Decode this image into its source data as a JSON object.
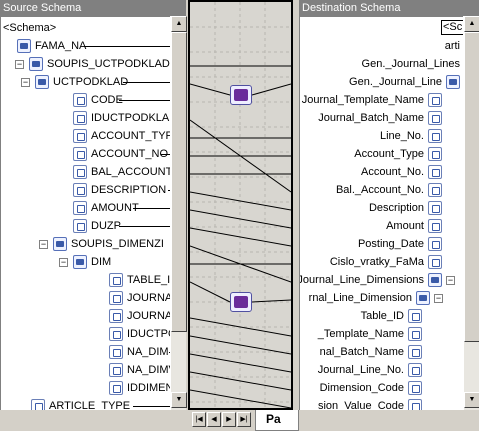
{
  "source": {
    "title": "Source Schema",
    "header_row": "<Schema>",
    "nodes": [
      {
        "label": "FAMA_NA",
        "kind": "record"
      },
      {
        "label": "SOUPIS_UCTPODKLADU",
        "kind": "record"
      },
      {
        "label": "UCTPODKLAD",
        "kind": "record"
      },
      {
        "label": "CODE",
        "kind": "field"
      },
      {
        "label": "IDUCTPODKLAD",
        "kind": "field"
      },
      {
        "label": "ACCOUNT_TYPE",
        "kind": "field"
      },
      {
        "label": "ACCOUNT_NO",
        "kind": "field"
      },
      {
        "label": "BAL_ACCOUNT_NO",
        "kind": "field"
      },
      {
        "label": "DESCRIPTION",
        "kind": "field"
      },
      {
        "label": "AMOUNT",
        "kind": "field"
      },
      {
        "label": "DUZP",
        "kind": "field"
      },
      {
        "label": "SOUPIS_DIMENZI",
        "kind": "record"
      },
      {
        "label": "DIM",
        "kind": "record"
      },
      {
        "label": "TABLE_ID",
        "kind": "field"
      },
      {
        "label": "JOURNAL_",
        "kind": "field"
      },
      {
        "label": "JOURNAL_",
        "kind": "field"
      },
      {
        "label": "IDUCTPOD",
        "kind": "field"
      },
      {
        "label": "NA_DIM",
        "kind": "field"
      },
      {
        "label": "NA_DIMVA",
        "kind": "field"
      },
      {
        "label": "IDDIMENZE",
        "kind": "field"
      },
      {
        "label": "ARTICLE_TYPE",
        "kind": "field"
      }
    ]
  },
  "destination": {
    "title": "Destination Schema",
    "header_row": "<Sc",
    "nodes": [
      {
        "label": "arti"
      },
      {
        "label": "Gen._Journal_Lines"
      },
      {
        "label": "Gen._Journal_Line"
      },
      {
        "label": "Journal_Template_Name"
      },
      {
        "label": "Journal_Batch_Name"
      },
      {
        "label": "Line_No."
      },
      {
        "label": "Account_Type"
      },
      {
        "label": "Account_No."
      },
      {
        "label": "Bal._Account_No."
      },
      {
        "label": "Description"
      },
      {
        "label": "Amount"
      },
      {
        "label": "Posting_Date"
      },
      {
        "label": "Cislo_vratky_FaMa"
      },
      {
        "label": "Journal_Line_Dimensions"
      },
      {
        "label": "rnal_Line_Dimension"
      },
      {
        "label": "Table_ID"
      },
      {
        "label": "_Template_Name"
      },
      {
        "label": "nal_Batch_Name"
      },
      {
        "label": "Journal_Line_No."
      },
      {
        "label": "Dimension_Code"
      },
      {
        "label": "sion_Value_Code"
      }
    ]
  },
  "mapper": {
    "tab_label": "Pa",
    "nav": [
      "first",
      "prev",
      "next",
      "last"
    ]
  },
  "colors": {
    "title_bg": "#808080",
    "grid_bg": "#d8d6d0",
    "functoid": "#6a2c9a"
  }
}
